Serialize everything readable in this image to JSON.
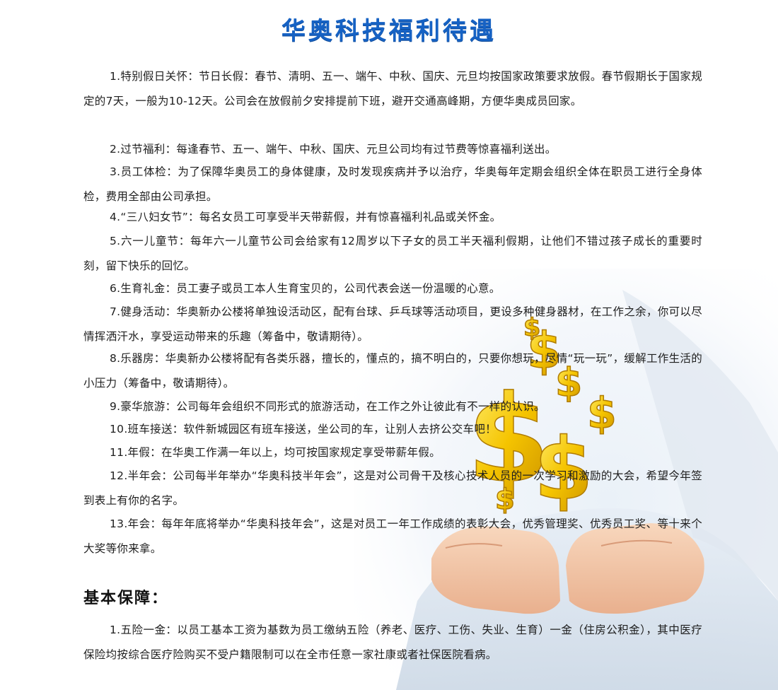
{
  "page_title": "华奥科技福利待遇",
  "benefits": [
    "1.特别假日关怀：节日长假：春节、清明、五一、端午、中秋、国庆、元旦均按国家政策要求放假。春节假期长于国家规定的7天，一般为10-12天。公司会在放假前夕安排提前下班，避开交通高峰期，方便华奥成员回家。",
    "2.过节福利：每逢春节、五一、端午、中秋、国庆、元旦公司均有过节费等惊喜福利送出。",
    "3.员工体检：为了保障华奥员工的身体健康，及时发现疾病并予以治疗，华奥每年定期会组织全体在职员工进行全身体检，费用全部由公司承担。",
    "4.“三八妇女节”：每名女员工可享受半天带薪假，并有惊喜福利礼品或关怀金。",
    "5.六一儿童节：每年六一儿童节公司会给家有12周岁以下子女的员工半天福利假期，让他们不错过孩子成长的重要时刻，留下快乐的回忆。",
    "6.生育礼金：员工妻子或员工本人生育宝贝的，公司代表会送一份温暖的心意。",
    "7.健身活动：华奥新办公楼将单独设活动区，配有台球、乒乓球等活动项目，更设多种健身器材，在工作之余，你可以尽情挥洒汗水，享受运动带来的乐趣（筹备中，敬请期待）。",
    "8.乐器房：华奥新办公楼将配有各类乐器，擅长的，懂点的，搞不明白的，只要你想玩，尽情“玩一玩”，缓解工作生活的小压力（筹备中，敬请期待）。",
    "9.豪华旅游：公司每年会组织不同形式的旅游活动，在工作之外让彼此有不一样的认识。",
    "10.班车接送：软件新城园区有班车接送，坐公司的车，让别人去挤公交车吧！",
    "11.年假：在华奥工作满一年以上，均可按国家规定享受带薪年假。",
    "12.半年会：公司每半年举办“华奥科技半年会”，这是对公司骨干及核心技术人员的一次学习和激励的大会，希望今年签到表上有你的名字。",
    "13.年会：每年年底将举办“华奥科技年会”，这是对员工一年工作成绩的表彰大会，优秀管理奖、优秀员工奖、等十来个大奖等你来拿。"
  ],
  "basic_section": {
    "heading": "基本保障：",
    "items": [
      "1.五险一金：以员工基本工资为基数为员工缴纳五险（养老、医疗、工伤、失业、生育）一金（住房公积金），其中医疗保险均按综合医疗险购买不受户籍限制可以在全市任意一家社康或者社保医院看病。"
    ]
  },
  "colors": {
    "title": "#1662c4",
    "coin_gold": "#f2c200",
    "skin": "#f3c9a8"
  }
}
